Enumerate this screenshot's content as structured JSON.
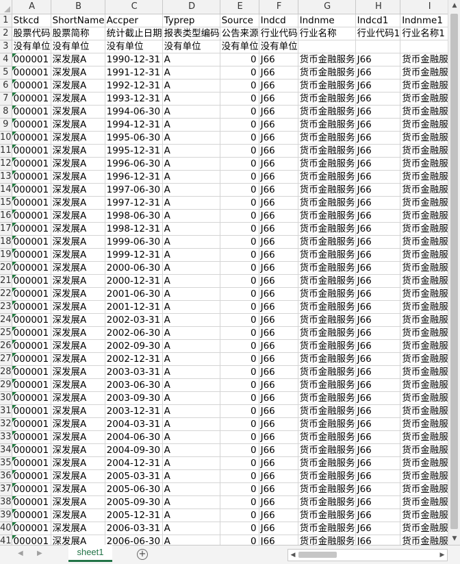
{
  "columns": [
    "A",
    "B",
    "C",
    "D",
    "E",
    "F",
    "G",
    "H",
    "I"
  ],
  "header_rows": [
    {
      "num": "1",
      "cells": [
        "Stkcd",
        "ShortName",
        "Accper",
        "Typrep",
        "Source",
        "Indcd",
        "Indnme",
        "Indcd1",
        "Indnme1"
      ]
    },
    {
      "num": "2",
      "cells": [
        "股票代码",
        "股票简称",
        "统计截止日期",
        "报表类型编码",
        "公告来源",
        "行业代码",
        "行业名称",
        "行业代码1",
        "行业名称1"
      ]
    },
    {
      "num": "3",
      "cells": [
        "没有单位",
        "没有单位",
        "没有单位",
        "没有单位",
        "没有单位",
        "没有单位",
        "",
        "",
        ""
      ]
    }
  ],
  "data_rows": [
    {
      "num": "4",
      "stkcd": "000001",
      "name": "深发展A",
      "accper": "1990-12-31",
      "typrep": "A",
      "source": "0",
      "indcd": "J66",
      "indnme": "货币金融服务",
      "indcd1": "J66",
      "indnme1": "货币金融服务"
    },
    {
      "num": "5",
      "stkcd": "000001",
      "name": "深发展A",
      "accper": "1991-12-31",
      "typrep": "A",
      "source": "0",
      "indcd": "J66",
      "indnme": "货币金融服务",
      "indcd1": "J66",
      "indnme1": "货币金融服务"
    },
    {
      "num": "6",
      "stkcd": "000001",
      "name": "深发展A",
      "accper": "1992-12-31",
      "typrep": "A",
      "source": "0",
      "indcd": "J66",
      "indnme": "货币金融服务",
      "indcd1": "J66",
      "indnme1": "货币金融服务"
    },
    {
      "num": "7",
      "stkcd": "000001",
      "name": "深发展A",
      "accper": "1993-12-31",
      "typrep": "A",
      "source": "0",
      "indcd": "J66",
      "indnme": "货币金融服务",
      "indcd1": "J66",
      "indnme1": "货币金融服务"
    },
    {
      "num": "8",
      "stkcd": "000001",
      "name": "深发展A",
      "accper": "1994-06-30",
      "typrep": "A",
      "source": "0",
      "indcd": "J66",
      "indnme": "货币金融服务",
      "indcd1": "J66",
      "indnme1": "货币金融服务"
    },
    {
      "num": "9",
      "stkcd": "000001",
      "name": "深发展A",
      "accper": "1994-12-31",
      "typrep": "A",
      "source": "0",
      "indcd": "J66",
      "indnme": "货币金融服务",
      "indcd1": "J66",
      "indnme1": "货币金融服务"
    },
    {
      "num": "10",
      "stkcd": "000001",
      "name": "深发展A",
      "accper": "1995-06-30",
      "typrep": "A",
      "source": "0",
      "indcd": "J66",
      "indnme": "货币金融服务",
      "indcd1": "J66",
      "indnme1": "货币金融服务"
    },
    {
      "num": "11",
      "stkcd": "000001",
      "name": "深发展A",
      "accper": "1995-12-31",
      "typrep": "A",
      "source": "0",
      "indcd": "J66",
      "indnme": "货币金融服务",
      "indcd1": "J66",
      "indnme1": "货币金融服务"
    },
    {
      "num": "12",
      "stkcd": "000001",
      "name": "深发展A",
      "accper": "1996-06-30",
      "typrep": "A",
      "source": "0",
      "indcd": "J66",
      "indnme": "货币金融服务",
      "indcd1": "J66",
      "indnme1": "货币金融服务"
    },
    {
      "num": "13",
      "stkcd": "000001",
      "name": "深发展A",
      "accper": "1996-12-31",
      "typrep": "A",
      "source": "0",
      "indcd": "J66",
      "indnme": "货币金融服务",
      "indcd1": "J66",
      "indnme1": "货币金融服务"
    },
    {
      "num": "14",
      "stkcd": "000001",
      "name": "深发展A",
      "accper": "1997-06-30",
      "typrep": "A",
      "source": "0",
      "indcd": "J66",
      "indnme": "货币金融服务",
      "indcd1": "J66",
      "indnme1": "货币金融服务"
    },
    {
      "num": "15",
      "stkcd": "000001",
      "name": "深发展A",
      "accper": "1997-12-31",
      "typrep": "A",
      "source": "0",
      "indcd": "J66",
      "indnme": "货币金融服务",
      "indcd1": "J66",
      "indnme1": "货币金融服务"
    },
    {
      "num": "16",
      "stkcd": "000001",
      "name": "深发展A",
      "accper": "1998-06-30",
      "typrep": "A",
      "source": "0",
      "indcd": "J66",
      "indnme": "货币金融服务",
      "indcd1": "J66",
      "indnme1": "货币金融服务"
    },
    {
      "num": "17",
      "stkcd": "000001",
      "name": "深发展A",
      "accper": "1998-12-31",
      "typrep": "A",
      "source": "0",
      "indcd": "J66",
      "indnme": "货币金融服务",
      "indcd1": "J66",
      "indnme1": "货币金融服务"
    },
    {
      "num": "18",
      "stkcd": "000001",
      "name": "深发展A",
      "accper": "1999-06-30",
      "typrep": "A",
      "source": "0",
      "indcd": "J66",
      "indnme": "货币金融服务",
      "indcd1": "J66",
      "indnme1": "货币金融服务"
    },
    {
      "num": "19",
      "stkcd": "000001",
      "name": "深发展A",
      "accper": "1999-12-31",
      "typrep": "A",
      "source": "0",
      "indcd": "J66",
      "indnme": "货币金融服务",
      "indcd1": "J66",
      "indnme1": "货币金融服务"
    },
    {
      "num": "20",
      "stkcd": "000001",
      "name": "深发展A",
      "accper": "2000-06-30",
      "typrep": "A",
      "source": "0",
      "indcd": "J66",
      "indnme": "货币金融服务",
      "indcd1": "J66",
      "indnme1": "货币金融服务"
    },
    {
      "num": "21",
      "stkcd": "000001",
      "name": "深发展A",
      "accper": "2000-12-31",
      "typrep": "A",
      "source": "0",
      "indcd": "J66",
      "indnme": "货币金融服务",
      "indcd1": "J66",
      "indnme1": "货币金融服务"
    },
    {
      "num": "22",
      "stkcd": "000001",
      "name": "深发展A",
      "accper": "2001-06-30",
      "typrep": "A",
      "source": "0",
      "indcd": "J66",
      "indnme": "货币金融服务",
      "indcd1": "J66",
      "indnme1": "货币金融服务"
    },
    {
      "num": "23",
      "stkcd": "000001",
      "name": "深发展A",
      "accper": "2001-12-31",
      "typrep": "A",
      "source": "0",
      "indcd": "J66",
      "indnme": "货币金融服务",
      "indcd1": "J66",
      "indnme1": "货币金融服务"
    },
    {
      "num": "24",
      "stkcd": "000001",
      "name": "深发展A",
      "accper": "2002-03-31",
      "typrep": "A",
      "source": "0",
      "indcd": "J66",
      "indnme": "货币金融服务",
      "indcd1": "J66",
      "indnme1": "货币金融服务"
    },
    {
      "num": "25",
      "stkcd": "000001",
      "name": "深发展A",
      "accper": "2002-06-30",
      "typrep": "A",
      "source": "0",
      "indcd": "J66",
      "indnme": "货币金融服务",
      "indcd1": "J66",
      "indnme1": "货币金融服务"
    },
    {
      "num": "26",
      "stkcd": "000001",
      "name": "深发展A",
      "accper": "2002-09-30",
      "typrep": "A",
      "source": "0",
      "indcd": "J66",
      "indnme": "货币金融服务",
      "indcd1": "J66",
      "indnme1": "货币金融服务"
    },
    {
      "num": "27",
      "stkcd": "000001",
      "name": "深发展A",
      "accper": "2002-12-31",
      "typrep": "A",
      "source": "0",
      "indcd": "J66",
      "indnme": "货币金融服务",
      "indcd1": "J66",
      "indnme1": "货币金融服务"
    },
    {
      "num": "28",
      "stkcd": "000001",
      "name": "深发展A",
      "accper": "2003-03-31",
      "typrep": "A",
      "source": "0",
      "indcd": "J66",
      "indnme": "货币金融服务",
      "indcd1": "J66",
      "indnme1": "货币金融服务"
    },
    {
      "num": "29",
      "stkcd": "000001",
      "name": "深发展A",
      "accper": "2003-06-30",
      "typrep": "A",
      "source": "0",
      "indcd": "J66",
      "indnme": "货币金融服务",
      "indcd1": "J66",
      "indnme1": "货币金融服务"
    },
    {
      "num": "30",
      "stkcd": "000001",
      "name": "深发展A",
      "accper": "2003-09-30",
      "typrep": "A",
      "source": "0",
      "indcd": "J66",
      "indnme": "货币金融服务",
      "indcd1": "J66",
      "indnme1": "货币金融服务"
    },
    {
      "num": "31",
      "stkcd": "000001",
      "name": "深发展A",
      "accper": "2003-12-31",
      "typrep": "A",
      "source": "0",
      "indcd": "J66",
      "indnme": "货币金融服务",
      "indcd1": "J66",
      "indnme1": "货币金融服务"
    },
    {
      "num": "32",
      "stkcd": "000001",
      "name": "深发展A",
      "accper": "2004-03-31",
      "typrep": "A",
      "source": "0",
      "indcd": "J66",
      "indnme": "货币金融服务",
      "indcd1": "J66",
      "indnme1": "货币金融服务"
    },
    {
      "num": "33",
      "stkcd": "000001",
      "name": "深发展A",
      "accper": "2004-06-30",
      "typrep": "A",
      "source": "0",
      "indcd": "J66",
      "indnme": "货币金融服务",
      "indcd1": "J66",
      "indnme1": "货币金融服务"
    },
    {
      "num": "34",
      "stkcd": "000001",
      "name": "深发展A",
      "accper": "2004-09-30",
      "typrep": "A",
      "source": "0",
      "indcd": "J66",
      "indnme": "货币金融服务",
      "indcd1": "J66",
      "indnme1": "货币金融服务"
    },
    {
      "num": "35",
      "stkcd": "000001",
      "name": "深发展A",
      "accper": "2004-12-31",
      "typrep": "A",
      "source": "0",
      "indcd": "J66",
      "indnme": "货币金融服务",
      "indcd1": "J66",
      "indnme1": "货币金融服务"
    },
    {
      "num": "36",
      "stkcd": "000001",
      "name": "深发展A",
      "accper": "2005-03-31",
      "typrep": "A",
      "source": "0",
      "indcd": "J66",
      "indnme": "货币金融服务",
      "indcd1": "J66",
      "indnme1": "货币金融服务"
    },
    {
      "num": "37",
      "stkcd": "000001",
      "name": "深发展A",
      "accper": "2005-06-30",
      "typrep": "A",
      "source": "0",
      "indcd": "J66",
      "indnme": "货币金融服务",
      "indcd1": "J66",
      "indnme1": "货币金融服务"
    },
    {
      "num": "38",
      "stkcd": "000001",
      "name": "深发展A",
      "accper": "2005-09-30",
      "typrep": "A",
      "source": "0",
      "indcd": "J66",
      "indnme": "货币金融服务",
      "indcd1": "J66",
      "indnme1": "货币金融服务"
    },
    {
      "num": "39",
      "stkcd": "000001",
      "name": "深发展A",
      "accper": "2005-12-31",
      "typrep": "A",
      "source": "0",
      "indcd": "J66",
      "indnme": "货币金融服务",
      "indcd1": "J66",
      "indnme1": "货币金融服务"
    },
    {
      "num": "40",
      "stkcd": "000001",
      "name": "深发展A",
      "accper": "2006-03-31",
      "typrep": "A",
      "source": "0",
      "indcd": "J66",
      "indnme": "货币金融服务",
      "indcd1": "J66",
      "indnme1": "货币金融服务"
    },
    {
      "num": "41",
      "stkcd": "000001",
      "name": "深发展A",
      "accper": "2006-06-30",
      "typrep": "A",
      "source": "0",
      "indcd": "J66",
      "indnme": "货币金融服务",
      "indcd1": "J66",
      "indnme1": "货币金融服务"
    }
  ],
  "sheet_tabs": [
    "sheet1"
  ],
  "icons": {
    "add_sheet": "plus-circle-icon",
    "nav_prev": "triangle-left-icon",
    "nav_next": "triangle-right-icon"
  },
  "colors": {
    "accent": "#217346",
    "text_marker": "#1f7a3e"
  }
}
